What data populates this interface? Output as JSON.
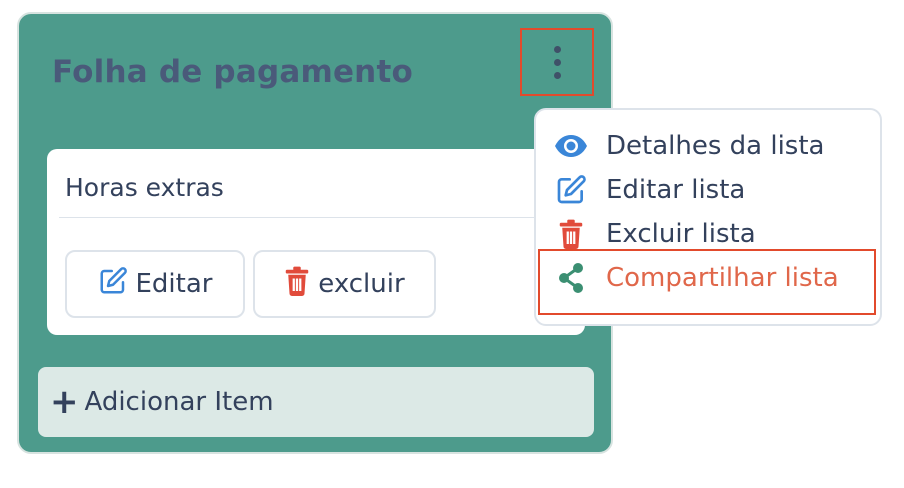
{
  "card": {
    "title": "Folha de pagamento",
    "item": {
      "title": "Horas extras",
      "edit_label": "Editar",
      "delete_label": "excluir"
    },
    "add_item_label": "Adicionar Item"
  },
  "menu": {
    "items": [
      {
        "label": "Detalhes da lista",
        "icon": "eye-icon"
      },
      {
        "label": "Editar lista",
        "icon": "edit-icon"
      },
      {
        "label": "Excluir lista",
        "icon": "trash-icon"
      },
      {
        "label": "Compartilhar lista",
        "icon": "share-icon"
      }
    ]
  },
  "colors": {
    "card_bg": "#4d9b8c",
    "highlight": "#e24a2c",
    "blue_icon": "#3a86d8",
    "red_icon": "#e14b3b",
    "share_icon": "#3b8f72",
    "share_text": "#e0674a"
  }
}
